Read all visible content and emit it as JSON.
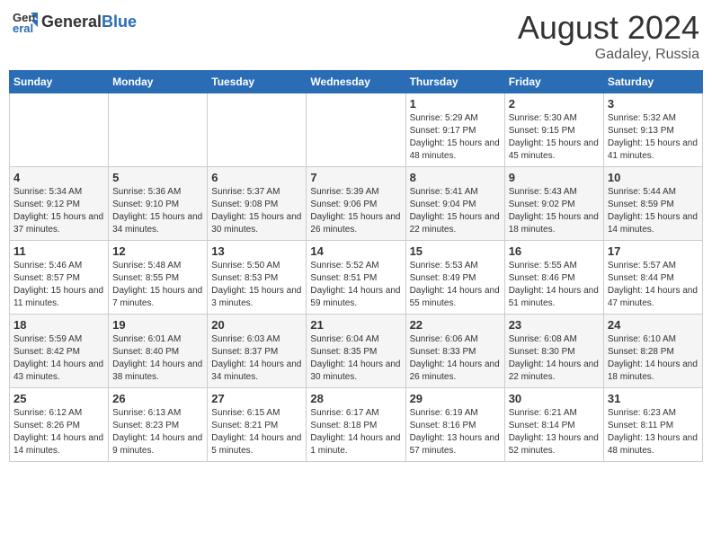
{
  "header": {
    "logo_general": "General",
    "logo_blue": "Blue",
    "month_year": "August 2024",
    "location": "Gadaley, Russia"
  },
  "weekdays": [
    "Sunday",
    "Monday",
    "Tuesday",
    "Wednesday",
    "Thursday",
    "Friday",
    "Saturday"
  ],
  "weeks": [
    [
      {
        "day": "",
        "sunrise": "",
        "sunset": "",
        "daylight": ""
      },
      {
        "day": "",
        "sunrise": "",
        "sunset": "",
        "daylight": ""
      },
      {
        "day": "",
        "sunrise": "",
        "sunset": "",
        "daylight": ""
      },
      {
        "day": "",
        "sunrise": "",
        "sunset": "",
        "daylight": ""
      },
      {
        "day": "1",
        "sunrise": "Sunrise: 5:29 AM",
        "sunset": "Sunset: 9:17 PM",
        "daylight": "Daylight: 15 hours and 48 minutes."
      },
      {
        "day": "2",
        "sunrise": "Sunrise: 5:30 AM",
        "sunset": "Sunset: 9:15 PM",
        "daylight": "Daylight: 15 hours and 45 minutes."
      },
      {
        "day": "3",
        "sunrise": "Sunrise: 5:32 AM",
        "sunset": "Sunset: 9:13 PM",
        "daylight": "Daylight: 15 hours and 41 minutes."
      }
    ],
    [
      {
        "day": "4",
        "sunrise": "Sunrise: 5:34 AM",
        "sunset": "Sunset: 9:12 PM",
        "daylight": "Daylight: 15 hours and 37 minutes."
      },
      {
        "day": "5",
        "sunrise": "Sunrise: 5:36 AM",
        "sunset": "Sunset: 9:10 PM",
        "daylight": "Daylight: 15 hours and 34 minutes."
      },
      {
        "day": "6",
        "sunrise": "Sunrise: 5:37 AM",
        "sunset": "Sunset: 9:08 PM",
        "daylight": "Daylight: 15 hours and 30 minutes."
      },
      {
        "day": "7",
        "sunrise": "Sunrise: 5:39 AM",
        "sunset": "Sunset: 9:06 PM",
        "daylight": "Daylight: 15 hours and 26 minutes."
      },
      {
        "day": "8",
        "sunrise": "Sunrise: 5:41 AM",
        "sunset": "Sunset: 9:04 PM",
        "daylight": "Daylight: 15 hours and 22 minutes."
      },
      {
        "day": "9",
        "sunrise": "Sunrise: 5:43 AM",
        "sunset": "Sunset: 9:02 PM",
        "daylight": "Daylight: 15 hours and 18 minutes."
      },
      {
        "day": "10",
        "sunrise": "Sunrise: 5:44 AM",
        "sunset": "Sunset: 8:59 PM",
        "daylight": "Daylight: 15 hours and 14 minutes."
      }
    ],
    [
      {
        "day": "11",
        "sunrise": "Sunrise: 5:46 AM",
        "sunset": "Sunset: 8:57 PM",
        "daylight": "Daylight: 15 hours and 11 minutes."
      },
      {
        "day": "12",
        "sunrise": "Sunrise: 5:48 AM",
        "sunset": "Sunset: 8:55 PM",
        "daylight": "Daylight: 15 hours and 7 minutes."
      },
      {
        "day": "13",
        "sunrise": "Sunrise: 5:50 AM",
        "sunset": "Sunset: 8:53 PM",
        "daylight": "Daylight: 15 hours and 3 minutes."
      },
      {
        "day": "14",
        "sunrise": "Sunrise: 5:52 AM",
        "sunset": "Sunset: 8:51 PM",
        "daylight": "Daylight: 14 hours and 59 minutes."
      },
      {
        "day": "15",
        "sunrise": "Sunrise: 5:53 AM",
        "sunset": "Sunset: 8:49 PM",
        "daylight": "Daylight: 14 hours and 55 minutes."
      },
      {
        "day": "16",
        "sunrise": "Sunrise: 5:55 AM",
        "sunset": "Sunset: 8:46 PM",
        "daylight": "Daylight: 14 hours and 51 minutes."
      },
      {
        "day": "17",
        "sunrise": "Sunrise: 5:57 AM",
        "sunset": "Sunset: 8:44 PM",
        "daylight": "Daylight: 14 hours and 47 minutes."
      }
    ],
    [
      {
        "day": "18",
        "sunrise": "Sunrise: 5:59 AM",
        "sunset": "Sunset: 8:42 PM",
        "daylight": "Daylight: 14 hours and 43 minutes."
      },
      {
        "day": "19",
        "sunrise": "Sunrise: 6:01 AM",
        "sunset": "Sunset: 8:40 PM",
        "daylight": "Daylight: 14 hours and 38 minutes."
      },
      {
        "day": "20",
        "sunrise": "Sunrise: 6:03 AM",
        "sunset": "Sunset: 8:37 PM",
        "daylight": "Daylight: 14 hours and 34 minutes."
      },
      {
        "day": "21",
        "sunrise": "Sunrise: 6:04 AM",
        "sunset": "Sunset: 8:35 PM",
        "daylight": "Daylight: 14 hours and 30 minutes."
      },
      {
        "day": "22",
        "sunrise": "Sunrise: 6:06 AM",
        "sunset": "Sunset: 8:33 PM",
        "daylight": "Daylight: 14 hours and 26 minutes."
      },
      {
        "day": "23",
        "sunrise": "Sunrise: 6:08 AM",
        "sunset": "Sunset: 8:30 PM",
        "daylight": "Daylight: 14 hours and 22 minutes."
      },
      {
        "day": "24",
        "sunrise": "Sunrise: 6:10 AM",
        "sunset": "Sunset: 8:28 PM",
        "daylight": "Daylight: 14 hours and 18 minutes."
      }
    ],
    [
      {
        "day": "25",
        "sunrise": "Sunrise: 6:12 AM",
        "sunset": "Sunset: 8:26 PM",
        "daylight": "Daylight: 14 hours and 14 minutes."
      },
      {
        "day": "26",
        "sunrise": "Sunrise: 6:13 AM",
        "sunset": "Sunset: 8:23 PM",
        "daylight": "Daylight: 14 hours and 9 minutes."
      },
      {
        "day": "27",
        "sunrise": "Sunrise: 6:15 AM",
        "sunset": "Sunset: 8:21 PM",
        "daylight": "Daylight: 14 hours and 5 minutes."
      },
      {
        "day": "28",
        "sunrise": "Sunrise: 6:17 AM",
        "sunset": "Sunset: 8:18 PM",
        "daylight": "Daylight: 14 hours and 1 minute."
      },
      {
        "day": "29",
        "sunrise": "Sunrise: 6:19 AM",
        "sunset": "Sunset: 8:16 PM",
        "daylight": "Daylight: 13 hours and 57 minutes."
      },
      {
        "day": "30",
        "sunrise": "Sunrise: 6:21 AM",
        "sunset": "Sunset: 8:14 PM",
        "daylight": "Daylight: 13 hours and 52 minutes."
      },
      {
        "day": "31",
        "sunrise": "Sunrise: 6:23 AM",
        "sunset": "Sunset: 8:11 PM",
        "daylight": "Daylight: 13 hours and 48 minutes."
      }
    ]
  ]
}
